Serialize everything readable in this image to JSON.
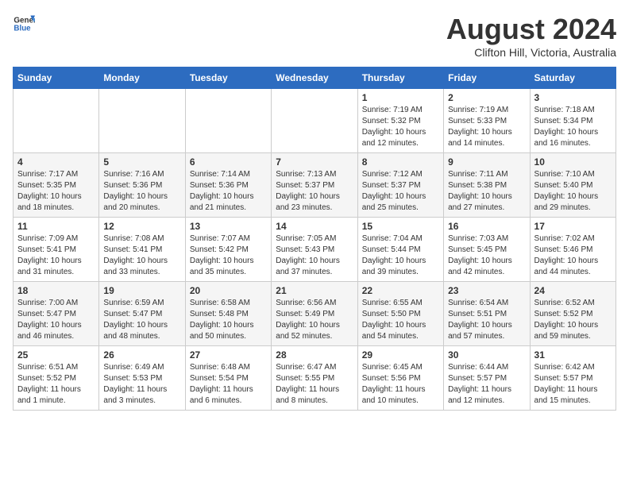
{
  "header": {
    "logo_general": "General",
    "logo_blue": "Blue",
    "month": "August 2024",
    "location": "Clifton Hill, Victoria, Australia"
  },
  "weekdays": [
    "Sunday",
    "Monday",
    "Tuesday",
    "Wednesday",
    "Thursday",
    "Friday",
    "Saturday"
  ],
  "weeks": [
    [
      {
        "day": "",
        "content": ""
      },
      {
        "day": "",
        "content": ""
      },
      {
        "day": "",
        "content": ""
      },
      {
        "day": "",
        "content": ""
      },
      {
        "day": "1",
        "content": "Sunrise: 7:19 AM\nSunset: 5:32 PM\nDaylight: 10 hours\nand 12 minutes."
      },
      {
        "day": "2",
        "content": "Sunrise: 7:19 AM\nSunset: 5:33 PM\nDaylight: 10 hours\nand 14 minutes."
      },
      {
        "day": "3",
        "content": "Sunrise: 7:18 AM\nSunset: 5:34 PM\nDaylight: 10 hours\nand 16 minutes."
      }
    ],
    [
      {
        "day": "4",
        "content": "Sunrise: 7:17 AM\nSunset: 5:35 PM\nDaylight: 10 hours\nand 18 minutes."
      },
      {
        "day": "5",
        "content": "Sunrise: 7:16 AM\nSunset: 5:36 PM\nDaylight: 10 hours\nand 20 minutes."
      },
      {
        "day": "6",
        "content": "Sunrise: 7:14 AM\nSunset: 5:36 PM\nDaylight: 10 hours\nand 21 minutes."
      },
      {
        "day": "7",
        "content": "Sunrise: 7:13 AM\nSunset: 5:37 PM\nDaylight: 10 hours\nand 23 minutes."
      },
      {
        "day": "8",
        "content": "Sunrise: 7:12 AM\nSunset: 5:37 PM\nDaylight: 10 hours\nand 25 minutes."
      },
      {
        "day": "9",
        "content": "Sunrise: 7:11 AM\nSunset: 5:38 PM\nDaylight: 10 hours\nand 27 minutes."
      },
      {
        "day": "10",
        "content": "Sunrise: 7:10 AM\nSunset: 5:40 PM\nDaylight: 10 hours\nand 29 minutes."
      }
    ],
    [
      {
        "day": "11",
        "content": "Sunrise: 7:09 AM\nSunset: 5:41 PM\nDaylight: 10 hours\nand 31 minutes."
      },
      {
        "day": "12",
        "content": "Sunrise: 7:08 AM\nSunset: 5:41 PM\nDaylight: 10 hours\nand 33 minutes."
      },
      {
        "day": "13",
        "content": "Sunrise: 7:07 AM\nSunset: 5:42 PM\nDaylight: 10 hours\nand 35 minutes."
      },
      {
        "day": "14",
        "content": "Sunrise: 7:05 AM\nSunset: 5:43 PM\nDaylight: 10 hours\nand 37 minutes."
      },
      {
        "day": "15",
        "content": "Sunrise: 7:04 AM\nSunset: 5:44 PM\nDaylight: 10 hours\nand 39 minutes."
      },
      {
        "day": "16",
        "content": "Sunrise: 7:03 AM\nSunset: 5:45 PM\nDaylight: 10 hours\nand 42 minutes."
      },
      {
        "day": "17",
        "content": "Sunrise: 7:02 AM\nSunset: 5:46 PM\nDaylight: 10 hours\nand 44 minutes."
      }
    ],
    [
      {
        "day": "18",
        "content": "Sunrise: 7:00 AM\nSunset: 5:47 PM\nDaylight: 10 hours\nand 46 minutes."
      },
      {
        "day": "19",
        "content": "Sunrise: 6:59 AM\nSunset: 5:47 PM\nDaylight: 10 hours\nand 48 minutes."
      },
      {
        "day": "20",
        "content": "Sunrise: 6:58 AM\nSunset: 5:48 PM\nDaylight: 10 hours\nand 50 minutes."
      },
      {
        "day": "21",
        "content": "Sunrise: 6:56 AM\nSunset: 5:49 PM\nDaylight: 10 hours\nand 52 minutes."
      },
      {
        "day": "22",
        "content": "Sunrise: 6:55 AM\nSunset: 5:50 PM\nDaylight: 10 hours\nand 54 minutes."
      },
      {
        "day": "23",
        "content": "Sunrise: 6:54 AM\nSunset: 5:51 PM\nDaylight: 10 hours\nand 57 minutes."
      },
      {
        "day": "24",
        "content": "Sunrise: 6:52 AM\nSunset: 5:52 PM\nDaylight: 10 hours\nand 59 minutes."
      }
    ],
    [
      {
        "day": "25",
        "content": "Sunrise: 6:51 AM\nSunset: 5:52 PM\nDaylight: 11 hours\nand 1 minute."
      },
      {
        "day": "26",
        "content": "Sunrise: 6:49 AM\nSunset: 5:53 PM\nDaylight: 11 hours\nand 3 minutes."
      },
      {
        "day": "27",
        "content": "Sunrise: 6:48 AM\nSunset: 5:54 PM\nDaylight: 11 hours\nand 6 minutes."
      },
      {
        "day": "28",
        "content": "Sunrise: 6:47 AM\nSunset: 5:55 PM\nDaylight: 11 hours\nand 8 minutes."
      },
      {
        "day": "29",
        "content": "Sunrise: 6:45 AM\nSunset: 5:56 PM\nDaylight: 11 hours\nand 10 minutes."
      },
      {
        "day": "30",
        "content": "Sunrise: 6:44 AM\nSunset: 5:57 PM\nDaylight: 11 hours\nand 12 minutes."
      },
      {
        "day": "31",
        "content": "Sunrise: 6:42 AM\nSunset: 5:57 PM\nDaylight: 11 hours\nand 15 minutes."
      }
    ]
  ]
}
